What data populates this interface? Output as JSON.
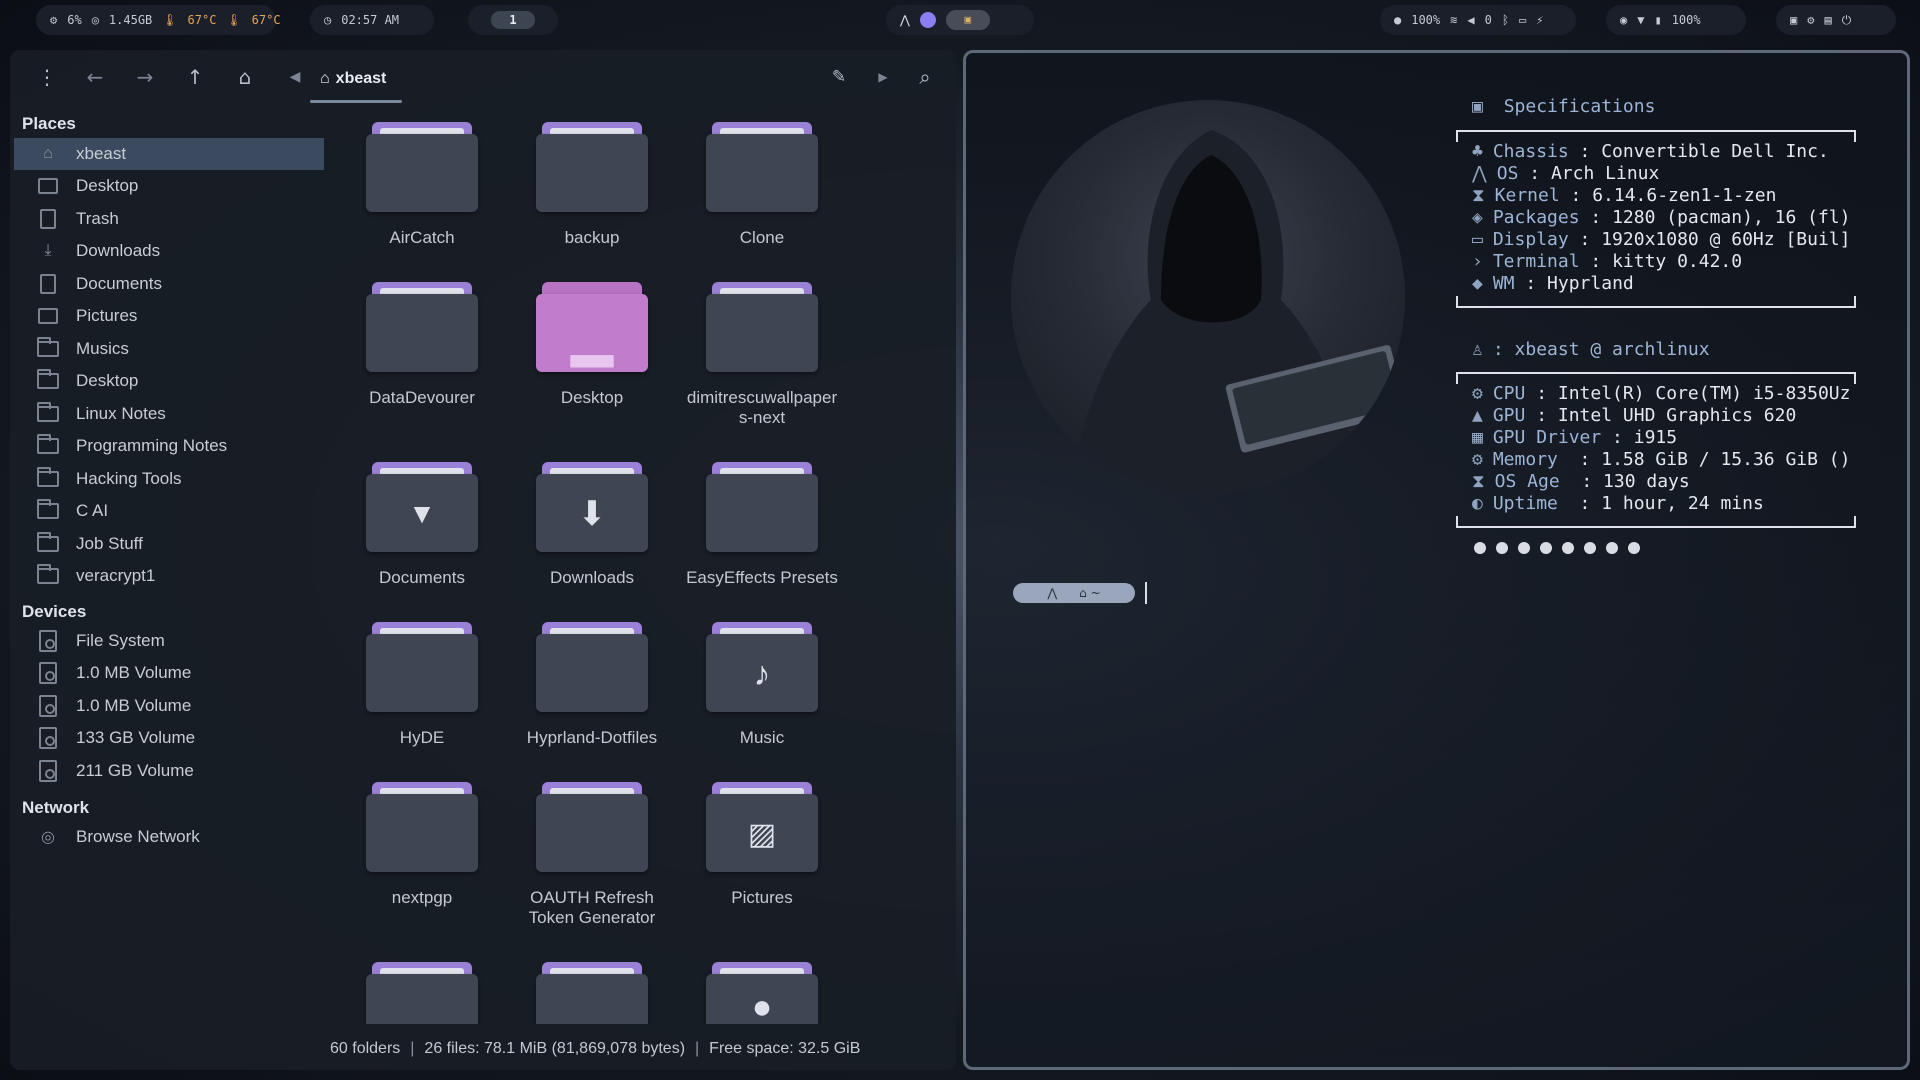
{
  "topbar": {
    "cpu": "6%",
    "mem": "1.45GB",
    "temp1": "67°C",
    "temp2": "67°C",
    "time": "02:57 AM",
    "workspace": "1",
    "battery": "100%",
    "volume": "0",
    "battery2": "100%"
  },
  "file_manager": {
    "breadcrumb": "xbeast",
    "sidebar": {
      "places_title": "Places",
      "places": [
        "xbeast",
        "Desktop",
        "Trash",
        "Downloads",
        "Documents",
        "Pictures",
        "Musics",
        "Desktop",
        "Linux Notes",
        "Programming Notes",
        "Hacking Tools",
        "C AI",
        "Job Stuff",
        "veracrypt1"
      ],
      "devices_title": "Devices",
      "devices": [
        "File System",
        "1.0 MB Volume",
        "1.0 MB Volume",
        "133 GB Volume",
        "211 GB Volume"
      ],
      "network_title": "Network",
      "network": [
        "Browse Network"
      ]
    },
    "folders": [
      {
        "name": "AirCatch"
      },
      {
        "name": "backup"
      },
      {
        "name": "Clone"
      },
      {
        "name": "DataDevourer"
      },
      {
        "name": "Desktop"
      },
      {
        "name": "dimitrescuwallpaper s-next"
      },
      {
        "name": "Documents"
      },
      {
        "name": "Downloads"
      },
      {
        "name": "EasyEffects Presets"
      },
      {
        "name": "HyDE"
      },
      {
        "name": "Hyprland-Dotfiles"
      },
      {
        "name": "Music"
      },
      {
        "name": "nextpgp"
      },
      {
        "name": "OAUTH Refresh Token Generator"
      },
      {
        "name": "Pictures"
      },
      {
        "name": ""
      },
      {
        "name": ""
      },
      {
        "name": ""
      }
    ],
    "status": {
      "folders": "60 folders",
      "files": "26 files: 78.1 MiB (81,869,078 bytes)",
      "free": "Free space: 32.5 GiB"
    }
  },
  "terminal": {
    "spec_title": "Specifications",
    "specs": [
      {
        "key": "Chassis",
        "value": "Convertible Dell Inc."
      },
      {
        "key": "OS",
        "value": "Arch Linux"
      },
      {
        "key": "Kernel",
        "value": "6.14.6-zen1-1-zen"
      },
      {
        "key": "Packages",
        "value": "1280 (pacman), 16 (fl)"
      },
      {
        "key": "Display",
        "value": "1920x1080 @ 60Hz [Buil]"
      },
      {
        "key": "Terminal",
        "value": "kitty 0.42.0"
      },
      {
        "key": "WM",
        "value": "Hyprland"
      }
    ],
    "user_line": ": xbeast @ archlinux",
    "hw": [
      {
        "key": "CPU",
        "value": "Intel(R) Core(TM) i5-8350Uz"
      },
      {
        "key": "GPU",
        "value": "Intel UHD Graphics 620"
      },
      {
        "key": "GPU Driver",
        "value": "i915"
      },
      {
        "key": "Memory",
        "value": "1.58 GiB / 15.36 GiB ()"
      },
      {
        "key": "OS Age",
        "value": "130 days"
      },
      {
        "key": "Uptime",
        "value": "1 hour, 24 mins"
      }
    ]
  }
}
